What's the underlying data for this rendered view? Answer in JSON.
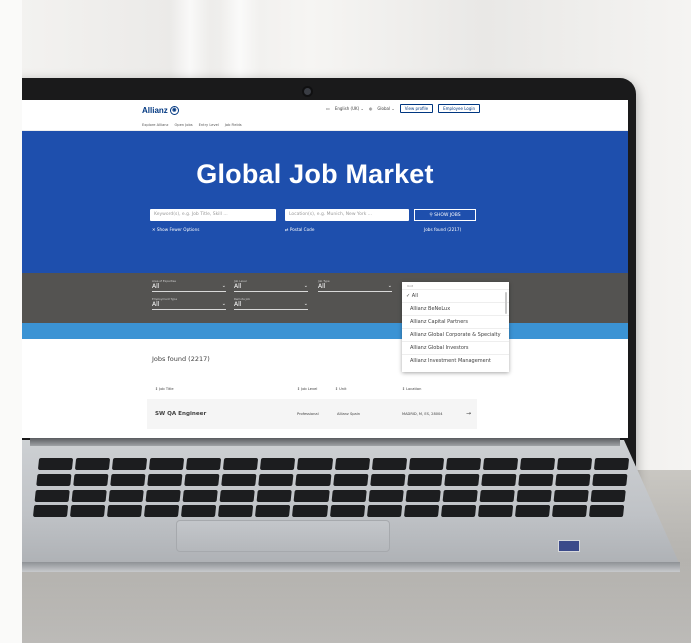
{
  "site": {
    "logo": "Allianz",
    "language": "English (UK)",
    "region": "Global",
    "view_profile": "View profile",
    "employee_login": "Employee Login",
    "subnav": [
      "Explore Allianz",
      "Open Jobs",
      "Entry Level",
      "Job Fields"
    ]
  },
  "hero": {
    "title": "Global Job Market",
    "keyword_placeholder": "Keyword(s), e.g. Job Title, Skill ...",
    "location_placeholder": "Location(s), e.g. Munich, New York ...",
    "show_jobs": "SHOW JOBS",
    "show_fewer": "Show Fewer Options",
    "postal_code": "Postal Code",
    "jobs_found_small": "Jobs found (2217)"
  },
  "filters": [
    {
      "label": "Area of Expertise",
      "value": "All"
    },
    {
      "label": "Job Level",
      "value": "All"
    },
    {
      "label": "Job Type",
      "value": "All"
    },
    {
      "label": "Employment Type",
      "value": "All"
    },
    {
      "label": "Remote Job",
      "value": "All"
    }
  ],
  "unit_dropdown": {
    "label": "Unit",
    "options": [
      "All",
      "Allianz BeNeLux",
      "Allianz Capital Partners",
      "Allianz Global Corporate & Specialty",
      "Allianz Global Investors",
      "Allianz Investment Management"
    ],
    "selected": "All"
  },
  "results": {
    "title": "Jobs found (2217)",
    "columns": [
      "Job Title",
      "Job Level",
      "Unit",
      "Location"
    ],
    "rows": [
      {
        "title": "SW QA Engineer",
        "level": "Professional",
        "unit": "Allianz Spain",
        "location": "MADRID, M, ES, 28004"
      }
    ]
  },
  "colors": {
    "brand_blue": "#003781",
    "hero_blue": "#1e4fad",
    "filter_gray": "#545351",
    "accent_blue": "#3b93d4"
  }
}
